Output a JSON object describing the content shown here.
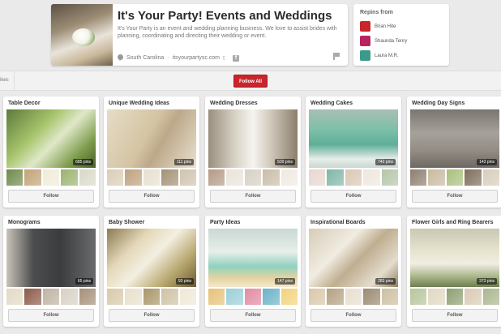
{
  "profile": {
    "name": "It's Your Party! Events and Weddings",
    "description": "It's Your Party is an event and wedding planning business. We love to assist brides with planning, coordinating and directing their wedding or event.",
    "location": "South Carolina",
    "separator": "·",
    "website": "itsyourpartysc.com",
    "twitter_glyph": "t",
    "facebook_glyph": "f"
  },
  "repins": {
    "title": "Repins from",
    "users": [
      {
        "name": "Brian Hite",
        "color": "#c9252b"
      },
      {
        "name": "Shaunda Tenry",
        "color": "#b7235e"
      },
      {
        "name": "Laura M.R.",
        "color": "#3d9a8b"
      }
    ]
  },
  "toolbar": {
    "left_text": "ikes",
    "follow_all_label": "Follow All"
  },
  "boards": [
    {
      "title": "Table Decor",
      "pins": "685 pins",
      "follow": "Follow",
      "main_bg": "linear-gradient(135deg,#5d7a3b 0%,#a5c36a 35%,#dfe8c8 55%,#7c9a4a 80%,#4a5f2c 100%)",
      "thumbs": [
        "#6f8a4a",
        "#c3a378",
        "#f1ecd8",
        "#9ab36e",
        "#d9d9c9"
      ]
    },
    {
      "title": "Unique Wedding Ideas",
      "pins": "111 pins",
      "follow": "Follow",
      "main_bg": "linear-gradient(120deg,#e6dcc6 0%,#d4c4a3 45%,#bca889 60%,#e9e1cf 100%)",
      "thumbs": [
        "#d9cdb5",
        "#bfa27e",
        "#e7e0d0",
        "#a39174",
        "#cfc3ad"
      ]
    },
    {
      "title": "Wedding Dresses",
      "pins": "509 pins",
      "follow": "Follow",
      "main_bg": "linear-gradient(90deg,#9a8f7d 0%,#d8d2c6 30%,#f6f4ef 50%,#d0c8ba 70%,#8b7f6c 100%)",
      "thumbs": [
        "#b59a86",
        "#e9e3db",
        "#d7d0c4",
        "#c9bda9",
        "#efe9e1"
      ]
    },
    {
      "title": "Wedding Cakes",
      "pins": "742 pins",
      "follow": "Follow",
      "main_bg": "linear-gradient(180deg,#a8bfb4 0%,#7dbfa8 35%,#5fae98 60%,#e8eee9 85%,#c9d6d0 100%)",
      "thumbs": [
        "#e7d7d0",
        "#7fb7a6",
        "#d9c8b4",
        "#efe7df",
        "#b5c6a8"
      ]
    },
    {
      "title": "Wedding Day Signs",
      "pins": "143 pins",
      "follow": "Follow",
      "main_bg": "linear-gradient(180deg,#7a7570 0%,#a6a19a 40%,#938d85 70%,#6e6862 100%)",
      "thumbs": [
        "#8c7f6f",
        "#c9b99f",
        "#a9c07e",
        "#7f6d5a",
        "#d7cdbb"
      ]
    },
    {
      "title": "Monograms",
      "pins": "65 pins",
      "follow": "Follow",
      "main_bg": "linear-gradient(90deg,#c9c3b9 0%,#4b4d4f 30%,#3a3c3e 60%,#6a6b6c 100%)",
      "thumbs": [
        "#e3d9c5",
        "#8c5a49",
        "#bfb3a2",
        "#d8d0c3",
        "#a58f78"
      ]
    },
    {
      "title": "Baby Shower",
      "pins": "93 pins",
      "follow": "Follow",
      "main_bg": "linear-gradient(135deg,#8c7a52 0%,#e3d8b8 30%,#f3efe2 50%,#b9a86f 75%,#6b5a35 100%)",
      "thumbs": [
        "#d8c9a8",
        "#e8e0cc",
        "#a99669",
        "#cfc1a3",
        "#efe8d7"
      ]
    },
    {
      "title": "Party Ideas",
      "pins": "147 pins",
      "follow": "Follow",
      "main_bg": "linear-gradient(180deg,#c9d9d3 0%,#e7efe9 40%,#8fd1bf 65%,#e7d4a0 85%,#f2e8d0 100%)",
      "thumbs": [
        "#e6c27a",
        "#9bcfd9",
        "#e28aa1",
        "#6bb3c7",
        "#f2d37c"
      ]
    },
    {
      "title": "Inspirational Boards",
      "pins": "283 pins",
      "follow": "Follow",
      "main_bg": "linear-gradient(135deg,#d6cbb6 0%,#f1ece1 35%,#bfae90 55%,#e4dccd 80%,#8f7e63 100%)",
      "thumbs": [
        "#d9c7a8",
        "#b5a182",
        "#e8ded0",
        "#9a8a71",
        "#cdbf9f"
      ]
    },
    {
      "title": "Flower Girls and Ring Bearers",
      "pins": "373 pins",
      "follow": "Follow",
      "main_bg": "linear-gradient(180deg,#c9c8b2 0%,#e8e4d0 40%,#f2ede4 60%,#9fae7e 85%,#6f7e52 100%)",
      "thumbs": [
        "#b7c59b",
        "#e1d8c3",
        "#8da072",
        "#d9cbb3",
        "#aab68c"
      ]
    }
  ]
}
